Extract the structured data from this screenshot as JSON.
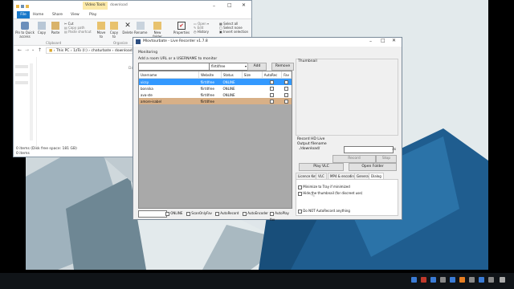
{
  "explorer": {
    "title": "download",
    "context_tab": "Video Tools",
    "menu_tabs": [
      "File",
      "Home",
      "Share",
      "View",
      "Play"
    ],
    "ribbon_buttons": {
      "pin": "Pin to Quick access",
      "copy": "Copy",
      "paste": "Paste",
      "cut": "Cut",
      "copy_path": "Copy path",
      "paste_shortcut": "Paste shortcut",
      "move_to": "Move to",
      "copy_to": "Copy to",
      "delete": "Delete",
      "rename": "Rename",
      "new_folder": "New folder",
      "properties": "Properties",
      "open": "Open",
      "edit": "Edit",
      "history": "History",
      "select_all": "Select all",
      "select_none": "Select none",
      "invert_selection": "Invert selection"
    },
    "groups": {
      "clipboard": "Clipboard",
      "organize": "Organize"
    },
    "breadcrumb": [
      "This PC",
      "1zTo (I:)",
      "chaturbate",
      "download"
    ],
    "column_date_modified": "Date modified",
    "status_items": "0 items (Disk free space: 181 GB)",
    "status_count": "0 items"
  },
  "recorder": {
    "title": "Mlovtourbate - Live Recorder v1.7.8",
    "tab_monitoring": "Monitoring",
    "add_label": "Add a room URL or a USERNAME to monitor",
    "site_select": "flirt4free",
    "add_button": "Add",
    "remove_button": "Remove",
    "columns": [
      "Username",
      "Website",
      "Status",
      "Size",
      "AutoRec",
      "Fav"
    ],
    "rows": [
      {
        "username": "vicsy",
        "website": "flirt4free",
        "status": "ONLINE",
        "size": "",
        "autorec": false,
        "fav": false,
        "style": "selected"
      },
      {
        "username": "bonnika",
        "website": "flirt4free",
        "status": "ONLINE",
        "size": "",
        "autorec": false,
        "fav": false,
        "style": "normal"
      },
      {
        "username": "ava-ste",
        "website": "flirt4free",
        "status": "ONLINE",
        "size": "",
        "autorec": false,
        "fav": false,
        "style": "normal"
      },
      {
        "username": "amore-isabel",
        "website": "flirt4free",
        "status": "",
        "size": "",
        "autorec": false,
        "fav": false,
        "style": "tan"
      }
    ],
    "thumbnail_label": "Thumbnail",
    "record_hd": "Record HD Live",
    "output_filename_label": "Output filename",
    "output_path": "./download/",
    "output_ext": ".ts",
    "record_button": "Record",
    "stop_button": "Stop",
    "play_vlc_button": "Play VLC",
    "open_folder_button": "Open Folder",
    "settings_tabs": [
      "Licence Key",
      "VLC",
      "MP4 & encoding",
      "General",
      "Dialog"
    ],
    "dialog_options": [
      {
        "label": "Minimize to Tray if minimized",
        "checked": false
      },
      {
        "label": "Hide the thumbnail (for discreet use)",
        "checked": false
      },
      {
        "label": "Do NOT AutoRecord anything",
        "checked": false
      }
    ],
    "bottom_filters": [
      "ONLINE",
      "ScanOnlyFav",
      "AutoRecord",
      "AutoEncoder",
      "AutoPlay fav"
    ]
  },
  "taskbar": {
    "colors": {
      "bg": "#101418",
      "accent": "#1e73d2"
    }
  }
}
